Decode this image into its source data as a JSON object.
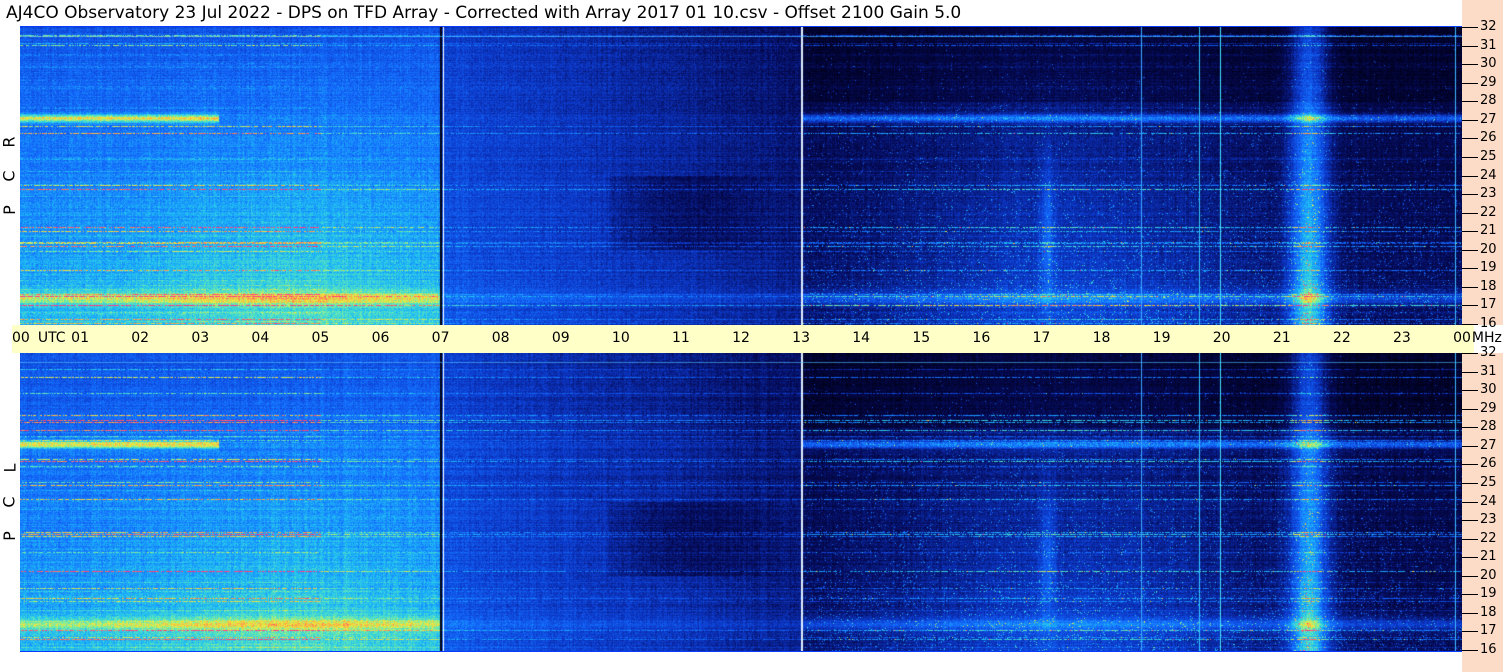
{
  "title": "AJ4CO Observatory  23 Jul 2022  -  DPS on TFD Array  -  Corrected with Array 2017 01 10.csv  -  Offset 2100  Gain 5.0",
  "chart_data": [
    {
      "type": "heatmap",
      "panel_label": [
        "R",
        "C",
        "P"
      ],
      "x": [
        "00",
        "01",
        "02",
        "03",
        "04",
        "05",
        "06",
        "07",
        "08",
        "09",
        "10",
        "11",
        "12",
        "13",
        "14",
        "15",
        "16",
        "17",
        "18",
        "19",
        "20",
        "21",
        "22",
        "23",
        "00"
      ],
      "xlabel": "UTC",
      "ylabel": "MHz",
      "ylim": [
        16,
        32
      ],
      "yticks": [
        32,
        31,
        30,
        29,
        28,
        27,
        26,
        25,
        24,
        23,
        22,
        21,
        20,
        19,
        18,
        17,
        16
      ]
    },
    {
      "type": "heatmap",
      "panel_label": [
        "L",
        "C",
        "P"
      ],
      "x": [
        "00",
        "01",
        "02",
        "03",
        "04",
        "05",
        "06",
        "07",
        "08",
        "09",
        "10",
        "11",
        "12",
        "13",
        "14",
        "15",
        "16",
        "17",
        "18",
        "19",
        "20",
        "21",
        "22",
        "23",
        "00"
      ],
      "xlabel": "UTC",
      "ylabel": "MHz",
      "ylim": [
        16,
        32
      ],
      "yticks": [
        32,
        31,
        30,
        29,
        28,
        27,
        26,
        25,
        24,
        23,
        22,
        21,
        20,
        19,
        18,
        17,
        16
      ]
    }
  ],
  "colors": {
    "background_low": "#000020",
    "mid": "#1e64ff",
    "high": "#ffe030",
    "timebar": "#ffffc8",
    "axis_bg": "#fcdcc6"
  }
}
